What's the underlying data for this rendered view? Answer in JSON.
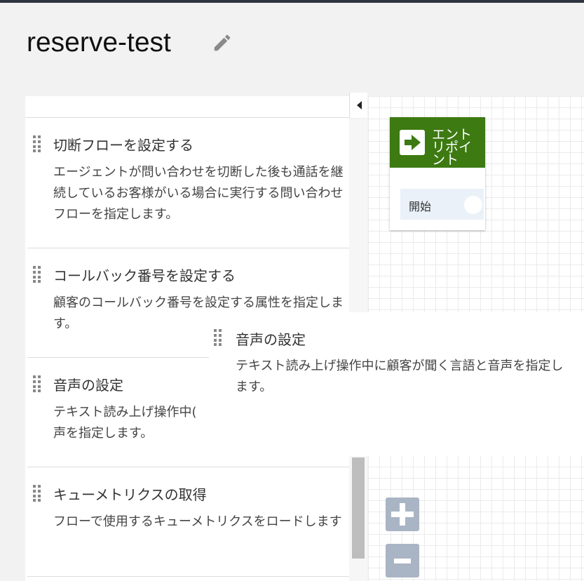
{
  "page": {
    "title": "reserve-test"
  },
  "icons": {
    "edit": "pencil-icon",
    "collapse": "triangle-left-icon",
    "grip": "drag-handle-icon",
    "entry": "arrow-right-icon",
    "zoom_in": "plus-icon",
    "zoom_out": "minus-icon"
  },
  "panel": {
    "blocks": [
      {
        "title": "切断フローを設定する",
        "desc": "エージェントが問い合わせを切断した後も通話を継続しているお客様がいる場合に実行する問い合わせフローを指定します。"
      },
      {
        "title": "コールバック番号を設定する",
        "desc": "顧客のコールバック番号を設定する属性を指定します。"
      },
      {
        "title": "音声の設定",
        "desc": "テキスト読み上げ操作中(",
        "desc2": "声を指定します。"
      },
      {
        "title": "キューメトリクスの取得",
        "desc": "フローで使用するキューメトリクスをロードします"
      }
    ]
  },
  "drag_card": {
    "title": "音声の設定",
    "desc": "テキスト読み上げ操作中に顧客が聞く言語と音声を指定します。"
  },
  "canvas": {
    "entry_block": {
      "title": "エントリポイント",
      "start_label": "開始"
    }
  },
  "colors": {
    "entry_header": "#3d7a12",
    "zoom_buttons": "#a9b5c4",
    "start_row": "#eaf1f9"
  }
}
